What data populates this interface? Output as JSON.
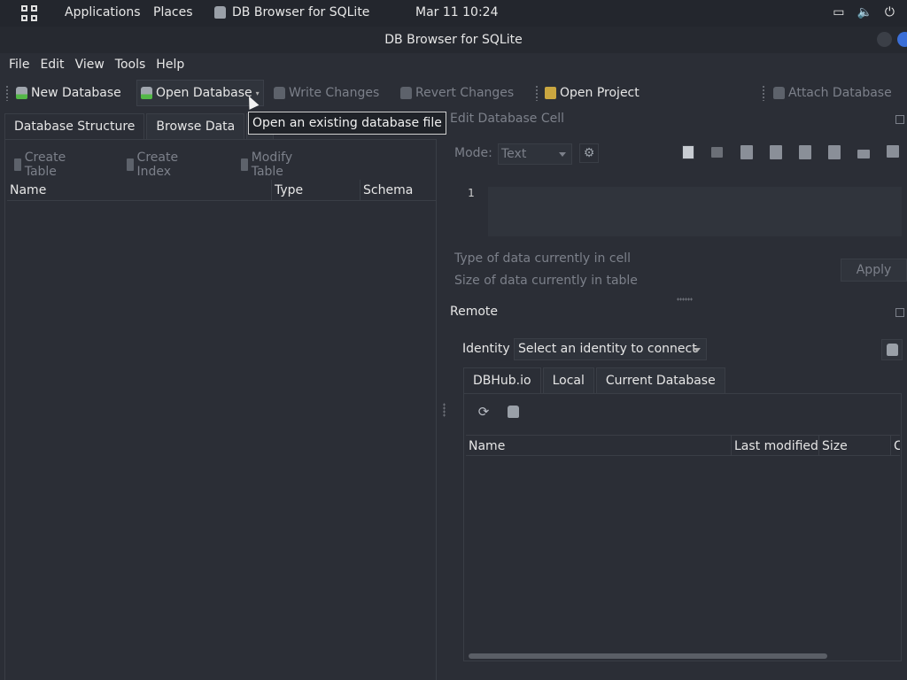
{
  "topbar": {
    "applications": "Applications",
    "places": "Places",
    "current_app": "DB Browser for SQLite",
    "clock": "Mar 11  10:24"
  },
  "window": {
    "title": "DB Browser for SQLite"
  },
  "menu": {
    "file": "File",
    "edit": "Edit",
    "view": "View",
    "tools": "Tools",
    "help": "Help"
  },
  "toolbar": {
    "new_database": "New Database",
    "open_database": "Open Database",
    "write_changes": "Write Changes",
    "revert_changes": "Revert Changes",
    "open_project": "Open Project",
    "attach_database": "Attach Database"
  },
  "tooltip": {
    "text": "Open an existing database file"
  },
  "left": {
    "tabs": [
      "Database Structure",
      "Browse Data",
      "E"
    ],
    "actions": {
      "create_table": "Create Table",
      "create_index": "Create Index",
      "modify_table": "Modify Table"
    },
    "columns": [
      "Name",
      "Type",
      "Schema"
    ]
  },
  "edit_cell": {
    "title": "Edit Database Cell",
    "mode_label": "Mode:",
    "mode_value": "Text",
    "line_number": "1",
    "type_info": "Type of data currently in cell",
    "size_info": "Size of data currently in table",
    "apply": "Apply"
  },
  "remote": {
    "title": "Remote",
    "identity_label": "Identity",
    "identity_placeholder": "Select an identity to connect",
    "tabs": [
      "DBHub.io",
      "Local",
      "Current Database"
    ],
    "columns": [
      "Name",
      "Last modified",
      "Size",
      "C"
    ]
  },
  "icons": {
    "apps": "grid-icon",
    "screen": "screen-icon",
    "volume": "volume-icon",
    "power": "power-icon",
    "refresh": "refresh-icon",
    "gear": "gear-icon"
  }
}
